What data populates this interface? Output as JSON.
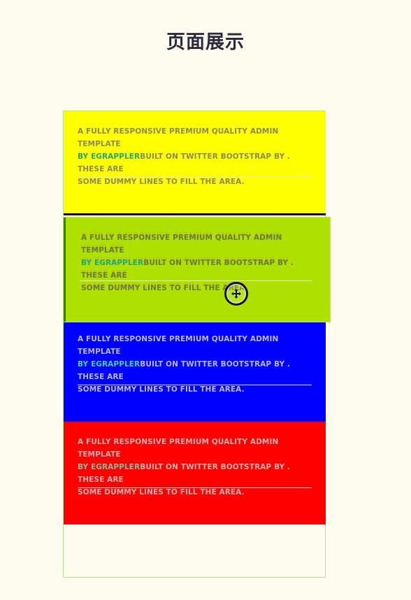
{
  "page": {
    "title": "页面展示"
  },
  "panels": [
    {
      "line1": "A FULLY RESPONSIVE PREMIUM QUALITY ADMIN TEMPLATE",
      "brand": "BY EGRAPPLER",
      "line2": "BUILT ON TWITTER BOOTSTRAP BY . THESE ARE",
      "line3": "SOME DUMMY LINES TO FILL THE AREA.",
      "color": "#ffff00"
    },
    {
      "line1": "A FULLY RESPONSIVE PREMIUM QUALITY ADMIN TEMPLATE",
      "brand": "BY EGRAPPLER",
      "line2": "BUILT ON TWITTER BOOTSTRAP BY . THESE ARE",
      "line3": "SOME DUMMY LINES TO FILL THE AREA.",
      "color": "#aee000"
    },
    {
      "line1": "A FULLY RESPONSIVE PREMIUM QUALITY ADMIN TEMPLATE",
      "brand": "BY EGRAPPLER",
      "line2": "BUILT ON TWITTER BOOTSTRAP BY . THESE ARE",
      "line3": "SOME DUMMY LINES TO FILL THE AREA.",
      "color": "#0000ff"
    },
    {
      "line1": "A FULLY RESPONSIVE PREMIUM QUALITY ADMIN TEMPLATE",
      "brand": "BY EGRAPPLER",
      "line2": "BUILT ON TWITTER BOOTSTRAP BY . THESE ARE",
      "line3": "SOME DUMMY LINES TO FILL THE AREA.",
      "color": "#ff0000"
    }
  ],
  "cursor": {
    "icon": "move-cursor-icon"
  }
}
